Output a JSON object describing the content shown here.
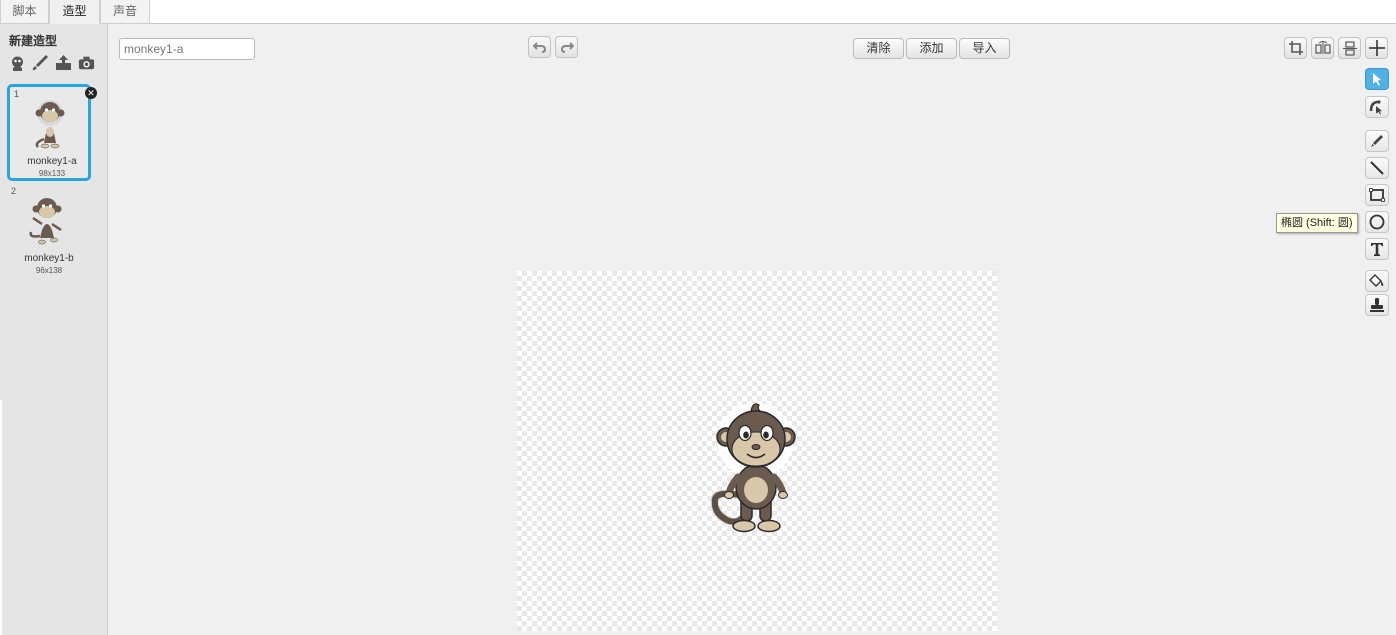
{
  "tabs": [
    {
      "label": "脚本",
      "active": false
    },
    {
      "label": "造型",
      "active": true
    },
    {
      "label": "声音",
      "active": false
    }
  ],
  "sidebar": {
    "title": "新建造型",
    "new_icons": [
      "sprite-library-icon",
      "paint-brush-icon",
      "upload-icon",
      "camera-icon"
    ],
    "costumes": [
      {
        "index": "1",
        "name": "monkey1-a",
        "size": "98x133",
        "selected": true
      },
      {
        "index": "2",
        "name": "monkey1-b",
        "size": "96x138",
        "selected": false
      }
    ]
  },
  "editor": {
    "costume_name": "monkey1-a",
    "buttons": {
      "clear": "清除",
      "add": "添加",
      "import": "导入"
    },
    "tooltip": "椭圆 (Shift: 圆)"
  },
  "colors": {
    "selection": "#29a5dd",
    "active_tool": "#4fb1e6",
    "monkey_fur": "#6b5a4e",
    "monkey_skin": "#d8c7a8"
  },
  "tools": [
    "select-icon",
    "reshape-icon",
    "pencil-icon",
    "line-icon",
    "rectangle-icon",
    "ellipse-icon",
    "text-icon",
    "fill-icon",
    "stamp-icon"
  ]
}
